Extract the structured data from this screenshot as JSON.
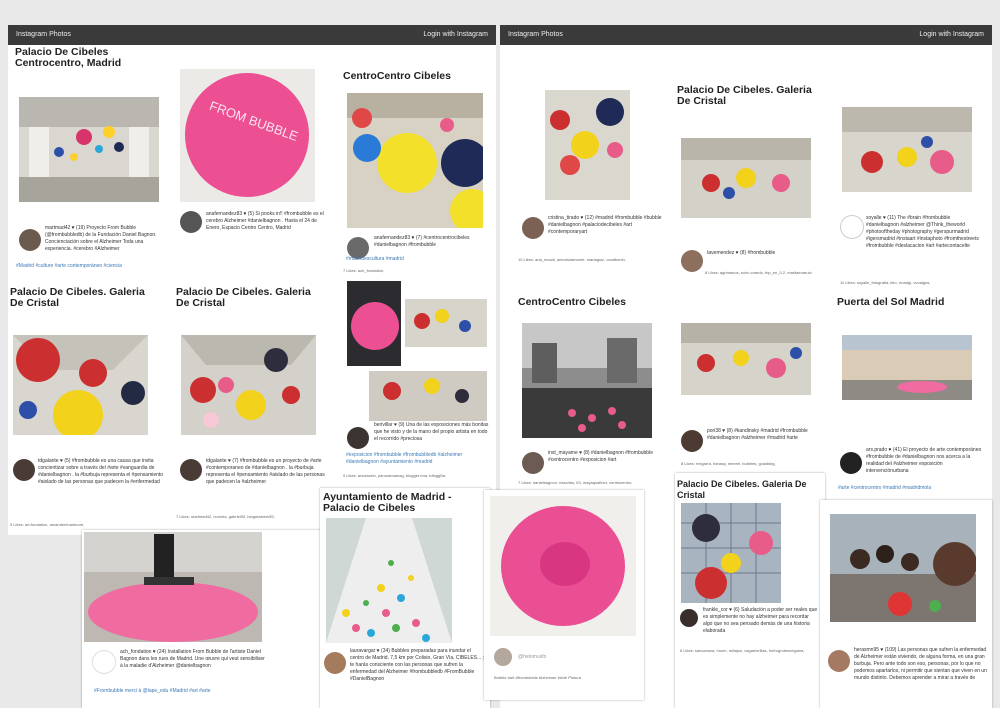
{
  "left_window": {
    "brand": "Instagram Photos",
    "login": "Login with Instagram",
    "locations": {
      "l1": "Palacio De Cibeles Centrocentro, Madrid",
      "l2": "CentroCentro Cibeles",
      "l3": "Palacio De Cibeles. Galeria De Cristal",
      "l4": "Palacio De Cibeles. Galeria De Cristal",
      "l5": "Ayuntamiento de Madrid - Palacio de Cibeles"
    },
    "posts": {
      "p1_caption": "martmad42 ♥ (19) Proyecto From Bubble (@frombubbledb) de la Fundación Daniel Bagnon. Concienciación sobre el Alzheimer Toda una experiencia. #cerebro #Alzheimer",
      "p1_tags": "#Madrid #culture #arte contemporáneo #ciencia",
      "p2_caption": "anafernandez83 ♥ (5) Si pooks in!! #frombubble es el cerebro Alzheimer #danielbagnon . Hasta el 24 de Enero, Espacio Centro Centro, Madrid",
      "p3_caption": "anafernandez83 ♥ (7) #centrocentrocibeles #danielbagnon #frombubble",
      "p3_tags": "#madridescultura #madrid",
      "p3_likes": "7 Likes: ach_fondation,",
      "p4_caption": "berivillar ♥ (9) Una de las exposiciones más bonitas que he visto y de la mano del propio artista en todo el recorrido #preciosa",
      "p4_tags": "#exposicion #frombubble #frombubbledb #alzheimer #danielbagnon #ayuntamiento #madrid",
      "p4_likes": "9 Likes: arsclavich, panoramamag, blogger.rma, tdfogg5a,",
      "p5_caption": "tdgalante ♥ (5) #frombubble es una causa que invita concientizar sobre a través del #arte #vanguardia de #danielbagnon . la #burbuja representa el #pensamiento #aislado de las personas que padecen la #enfermedad",
      "p5_likes": "5 Likes: art-fondation, amandemhardcore,",
      "p6_caption": "tdgalante ♥ (7) #frombubble es un proyecto de #arte #contemporaneo de #danielbagnon . la #burbuja representa el #pensamiento #aislado de las personas que padecen la #alzheimer",
      "p6_likes": "7 Likes: martmad42, rcoloria, gabriel93, blogmasters95,",
      "p7_caption": "ach_fondation ♥ (24) Installation From Bubble de l'artiste Daniel Bagnon dans les rues de Madrid. Une œuvre qui veut sensibiliser à la maladie d'Alzheimer @danielbagnon",
      "p7_tags": "#Frombubble merci à @lape_edu #Madrid #art #arte",
      "p8_caption": "lauravargar ♥ (34) Bubbles preparadas para inundar el centro de Madrid. 7,5 km por Colisio, Gran Vía, CIBELES... ; te harás consciente con las personas que sufren la enfermedad del Alzheimer #frombubbledb #FromBubble #DanielBagnon"
    }
  },
  "right_window": {
    "brand": "Instagram Photos",
    "login": "Login with Instagram",
    "locations": {
      "r1": "Palacio De Cibeles. Galeria De Cristal",
      "r2": "CentroCentro Cibeles",
      "r3": "Puerta del Sol Madrid",
      "r4": "Palacio De Cibeles. Galeria De Cristal"
    },
    "posts": {
      "q1_caption": "cristina_tirado ♥ (12) #madrid #frombubble #bubble #danielbagnon #palaciodecibeles #art #contemporaryart",
      "q1_likes": "10 Likes: ana_mcadi, antoniolamanre, mariaguiz, ocadbonin,",
      "q2_caption": "tavemendez ♥ (8) #frombubble",
      "q2_likes": "8 Likes: agrimanos, soiro.cnardo, trip_en_0.2, maritaenaruio",
      "q3_caption": "soyalle ♥ (11) The #brain #frombubble #danielbagnon #alzheimer @Think_theworld #photooftheday #photography #gerspurmadrid #igersmadrid #instaart #instaphoto #fromthestreets #frombubble #deslacacion #art #artecontacelte",
      "q3_likes": "11 Likes: soyalle_fotografia, kito, rmadgi, ovoaigns,",
      "q4_caption": "inst_mayame ♥ (8) #danielbagnon #frombubble #centrocentro #exposicion #art",
      "q4_likes": "7 Likes: danielbagnon, rlaschbs, 63, mayaquallrsrt, centrocentro,",
      "q5_caption": "pori38 ♥ (8) #kandinsky #madrid #frombubble #danielbagnon #alzheimer #madrid #arte",
      "q5_likes": "8 Likes: rmigarra, rlanasy, mnerel, bubbles, gcaldsbg,",
      "q6_caption": "ars.prado ♥ (41) El proyecto de arte contemporáneo #frombubble de #danielbagnon nos acerca a la realidad del #alzheimer exposición intervenciónurbana",
      "q6_tags": "#arte #centrocentro #madrid #madridmola",
      "q7_caption": "frankle_cor ♥ (6) Saludación a poder ser reales que es simplemente no hay alzheimer para recordar algo que no sea pensado demás de una historia elaborada",
      "q7_likes": "6 Likes: sanvanuza, hoom, miilajos, vaguelorillas, forfrogrutesnegolea,",
      "q8_caption": "@hetomusfo",
      "q8_meta": "Bubble #art #frombubble Alzheimer #Arte Pintura",
      "q9_caption": "herasmn95 ♥ (109) Las personas que sufren la enfermedad de Alzheimer están viviendo, de alguna forma, en una gran burbuja. Pero ante todo son eso, personas, por lo que no podemos apartarlos, ni permitir que sientan que viven en un mundo distinto. Debemos aprender a mirar a través de"
    }
  },
  "colors": {
    "topbar": "#3a3a3a",
    "link": "#3b79b6",
    "pink": "#e8508a"
  }
}
